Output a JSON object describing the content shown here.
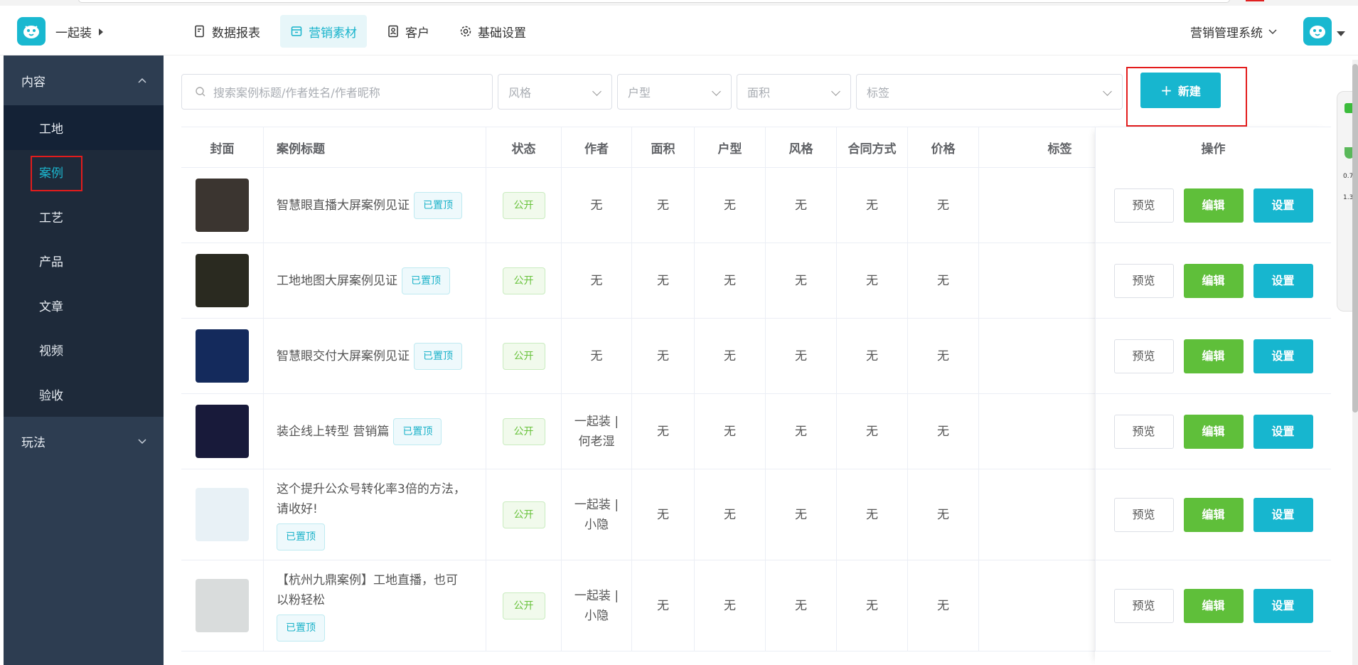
{
  "app": {
    "brand_name": "一起装",
    "system_menu": "营销管理系统"
  },
  "topnav": [
    {
      "label": "数据报表",
      "icon": "report-icon",
      "active": false
    },
    {
      "label": "营销素材",
      "icon": "material-icon",
      "active": true
    },
    {
      "label": "客户",
      "icon": "customer-icon",
      "active": false
    },
    {
      "label": "基础设置",
      "icon": "gear-icon",
      "active": false
    }
  ],
  "sidebar": {
    "group_content": "内容",
    "items": [
      "工地",
      "案例",
      "工艺",
      "产品",
      "文章",
      "视频",
      "验收"
    ],
    "active_item": "案例",
    "group_play": "玩法"
  },
  "filters": {
    "search_placeholder": "搜索案例标题/作者姓名/作者昵称",
    "style": "风格",
    "layout": "户型",
    "area": "面积",
    "tags": "标签",
    "new_button": "新建"
  },
  "table": {
    "headers": [
      "封面",
      "案例标题",
      "状态",
      "作者",
      "面积",
      "户型",
      "风格",
      "合同方式",
      "价格",
      "标签",
      "操作"
    ],
    "actions": {
      "preview": "预览",
      "edit": "编辑",
      "setting": "设置"
    },
    "rows": [
      {
        "title": "智慧眼直播大屏案例见证",
        "badge": "已置顶",
        "status": "公开",
        "author": "无",
        "area": "无",
        "layout": "无",
        "style": "无",
        "contract": "无",
        "price": "无",
        "tags": "",
        "cover_color": "#3b3530"
      },
      {
        "title": "工地地图大屏案例见证",
        "badge": "已置顶",
        "status": "公开",
        "author": "无",
        "area": "无",
        "layout": "无",
        "style": "无",
        "contract": "无",
        "price": "无",
        "tags": "",
        "cover_color": "#2a2a20"
      },
      {
        "title": "智慧眼交付大屏案例见证",
        "badge": "已置顶",
        "status": "公开",
        "author": "无",
        "area": "无",
        "layout": "无",
        "style": "无",
        "contract": "无",
        "price": "无",
        "tags": "",
        "cover_color": "#142a5c"
      },
      {
        "title": "装企线上转型 营销篇",
        "badge": "已置顶",
        "status": "公开",
        "author": "一起装 | 何老湿",
        "area": "无",
        "layout": "无",
        "style": "无",
        "contract": "无",
        "price": "无",
        "tags": "",
        "cover_color": "#181a3a"
      },
      {
        "title": "这个提升公众号转化率3倍的方法，请收好!",
        "badge": "已置顶",
        "status": "公开",
        "author": "一起装 | 小隐",
        "area": "无",
        "layout": "无",
        "style": "无",
        "contract": "无",
        "price": "无",
        "tags": "",
        "cover_color": "#e8f1f6"
      },
      {
        "title": "【杭州九鼎案例】工地直播，也可以粉轻松",
        "badge": "已置顶",
        "status": "公开",
        "author": "一起装 | 小隐",
        "area": "无",
        "layout": "无",
        "style": "无",
        "contract": "无",
        "price": "无",
        "tags": "",
        "cover_color": "#d9dcdc"
      }
    ]
  },
  "side_widget": {
    "speed_up": "0.7",
    "speed_down": "1.3"
  },
  "colors": {
    "accent": "#17b6cf",
    "sidebar_bg": "#2d3d51",
    "edit_green": "#5fbf3a",
    "highlight_red": "#e31c1c"
  }
}
